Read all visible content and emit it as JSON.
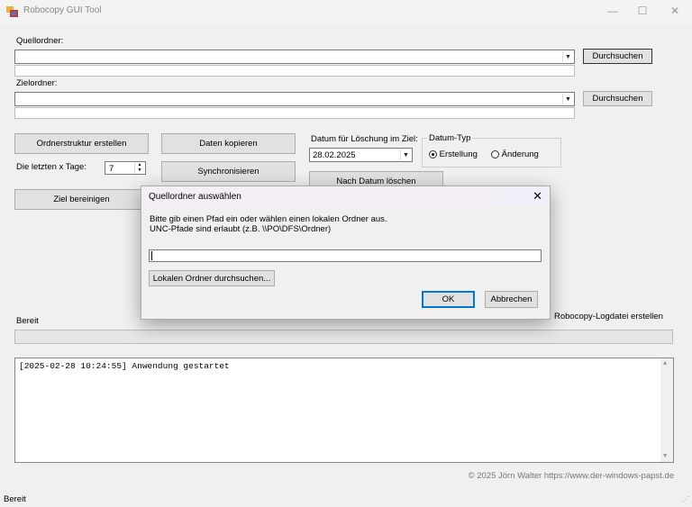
{
  "window": {
    "title": "Robocopy GUI Tool",
    "controls": {
      "minimize": "—",
      "maximize": "☐",
      "close": "✕"
    }
  },
  "source": {
    "label": "Quellordner:",
    "value": "",
    "browse_label": "Durchsuchen"
  },
  "target": {
    "label": "Zielordner:",
    "value": "",
    "browse_label": "Durchsuchen"
  },
  "actions": {
    "create_structure": "Ordnerstruktur erstellen",
    "copy_data": "Daten kopieren",
    "synchronize": "Synchronisieren",
    "clean_target": "Ziel bereinigen",
    "delete_by_date": "Nach Datum löschen"
  },
  "last_days": {
    "label": "Die letzten x Tage:",
    "value": "7"
  },
  "date_delete": {
    "label": "Datum für Löschung im Ziel:",
    "value": "28.02.2025"
  },
  "date_type": {
    "title": "Datum-Typ",
    "options": [
      {
        "label": "Erstellung",
        "selected": true
      },
      {
        "label": "Änderung",
        "selected": false
      }
    ]
  },
  "logfile_label": "Robocopy-Logdatei erstellen",
  "status_label": "Bereit",
  "log": {
    "lines": [
      "[2025-02-28 10:24:55] Anwendung gestartet"
    ]
  },
  "footer": "© 2025 Jörn Walter https://www.der-windows-papst.de",
  "statusbar": "Bereit",
  "dialog": {
    "title": "Quellordner auswählen",
    "message_line1": "Bitte gib einen Pfad ein oder wählen einen lokalen Ordner aus.",
    "message_line2": "UNC-Pfade sind erlaubt (z.B. \\\\PO\\DFS\\Ordner)",
    "input_value": "",
    "browse_local": "Lokalen Ordner durchsuchen...",
    "ok": "OK",
    "cancel": "Abbrechen",
    "close": "✕"
  },
  "colors": {
    "accent": "#0078d7",
    "window_bg": "#f0f0f0"
  }
}
